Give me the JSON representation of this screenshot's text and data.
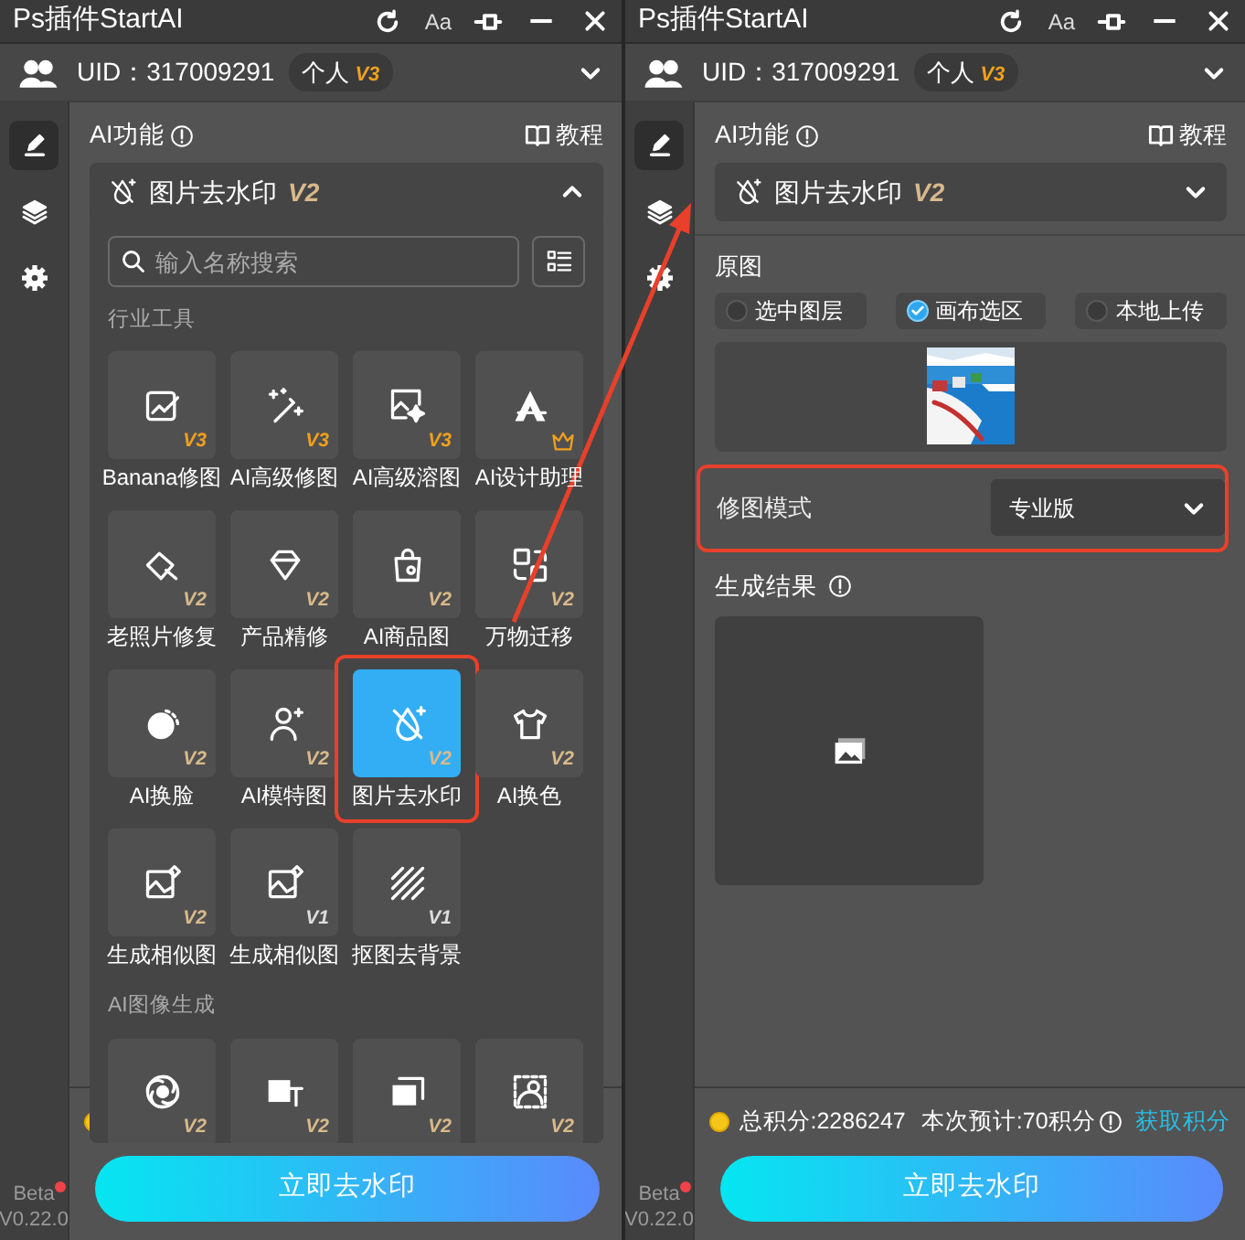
{
  "annotation_arrow": true,
  "panels": [
    {
      "title": "Ps插件StartAI",
      "font_button": "Aa",
      "user": {
        "uid": "UID：317009291",
        "plan": "个人",
        "plan_level": "V3"
      },
      "sidebar": {
        "items": [
          {
            "selected": true
          },
          {
            "selected": false
          },
          {
            "selected": false
          }
        ],
        "beta": "Beta",
        "notification": true,
        "version": "V0.22.0"
      },
      "section_title": "AI功能",
      "tutorial": "教程",
      "feature": {
        "label": "图片去水印",
        "version": "V2",
        "expanded": true
      },
      "picker": {
        "search_placeholder": "输入名称搜索",
        "groups": [
          {
            "title": "行业工具",
            "tiles": [
              {
                "label": "Banana修图",
                "version": "V3",
                "color": "#f0a01e",
                "selected": false,
                "highlighted": false
              },
              {
                "label": "AI高级修图",
                "version": "V3",
                "color": "#f0a01e",
                "selected": false,
                "highlighted": false
              },
              {
                "label": "AI高级溶图",
                "version": "V3",
                "color": "#f0a01e",
                "selected": false,
                "highlighted": false
              },
              {
                "label": "AI设计助理",
                "premium": true,
                "color": "#f0a01e",
                "selected": false,
                "highlighted": false
              },
              {
                "label": "老照片修复",
                "version": "V2",
                "color": "#d9b98a",
                "selected": false,
                "highlighted": false
              },
              {
                "label": "产品精修",
                "version": "V2",
                "color": "#d9b98a",
                "selected": false,
                "highlighted": false
              },
              {
                "label": "AI商品图",
                "version": "V2",
                "color": "#d9b98a",
                "selected": false,
                "highlighted": false
              },
              {
                "label": "万物迁移",
                "version": "V2",
                "color": "#d9b98a",
                "selected": false,
                "highlighted": false
              },
              {
                "label": "AI换脸",
                "version": "V2",
                "color": "#d9b98a",
                "selected": false,
                "highlighted": false
              },
              {
                "label": "AI模特图",
                "version": "V2",
                "color": "#d9b98a",
                "selected": false,
                "highlighted": false
              },
              {
                "label": "图片去水印",
                "version": "V2",
                "color": "#d9b98a",
                "selected": true,
                "highlighted": true
              },
              {
                "label": "AI换色",
                "version": "V2",
                "color": "#d9b98a",
                "selected": false,
                "highlighted": false
              },
              {
                "label": "生成相似图",
                "version": "V2",
                "color": "#d9b98a",
                "selected": false,
                "highlighted": false
              },
              {
                "label": "生成相似图",
                "version": "V1",
                "color": "#dddddd",
                "selected": false,
                "highlighted": false
              },
              {
                "label": "抠图去背景",
                "version": "V1",
                "color": "#dddddd",
                "selected": false,
                "highlighted": false
              }
            ]
          },
          {
            "title": "AI图像生成",
            "tiles": [
              {
                "version": "V2",
                "color": "#d9b98a",
                "selected": false,
                "highlighted": false
              },
              {
                "version": "V2",
                "color": "#d9b98a",
                "selected": false,
                "highlighted": false
              },
              {
                "version": "V2",
                "color": "#d9b98a",
                "selected": false,
                "highlighted": false
              },
              {
                "version": "V2",
                "color": "#d9b98a",
                "selected": false,
                "highlighted": false
              }
            ]
          }
        ]
      },
      "footer": {
        "coin": true
      },
      "action": "立即去水印"
    },
    {
      "title": "Ps插件StartAI",
      "font_button": "Aa",
      "user": {
        "uid": "UID：317009291",
        "plan": "个人",
        "plan_level": "V3"
      },
      "sidebar": {
        "items": [
          {
            "selected": true
          },
          {
            "selected": false
          },
          {
            "selected": false
          }
        ],
        "beta": "Beta",
        "notification": true,
        "version": "V0.22.0"
      },
      "section_title": "AI功能",
      "tutorial": "教程",
      "feature": {
        "label": "图片去水印",
        "version": "V2",
        "expanded": false
      },
      "source": {
        "title": "原图",
        "options": [
          {
            "label": "选中图层",
            "selected": false
          },
          {
            "label": "画布选区",
            "selected": true
          },
          {
            "label": "本地上传",
            "selected": false
          }
        ]
      },
      "mode": {
        "label": "修图模式",
        "value": "专业版",
        "highlighted": true
      },
      "result": {
        "title": "生成结果"
      },
      "footer": {
        "coin": true,
        "total": "总积分:2286247",
        "estimate": "本次预计:70积分",
        "link": "获取积分"
      },
      "action": "立即去水印"
    }
  ]
}
